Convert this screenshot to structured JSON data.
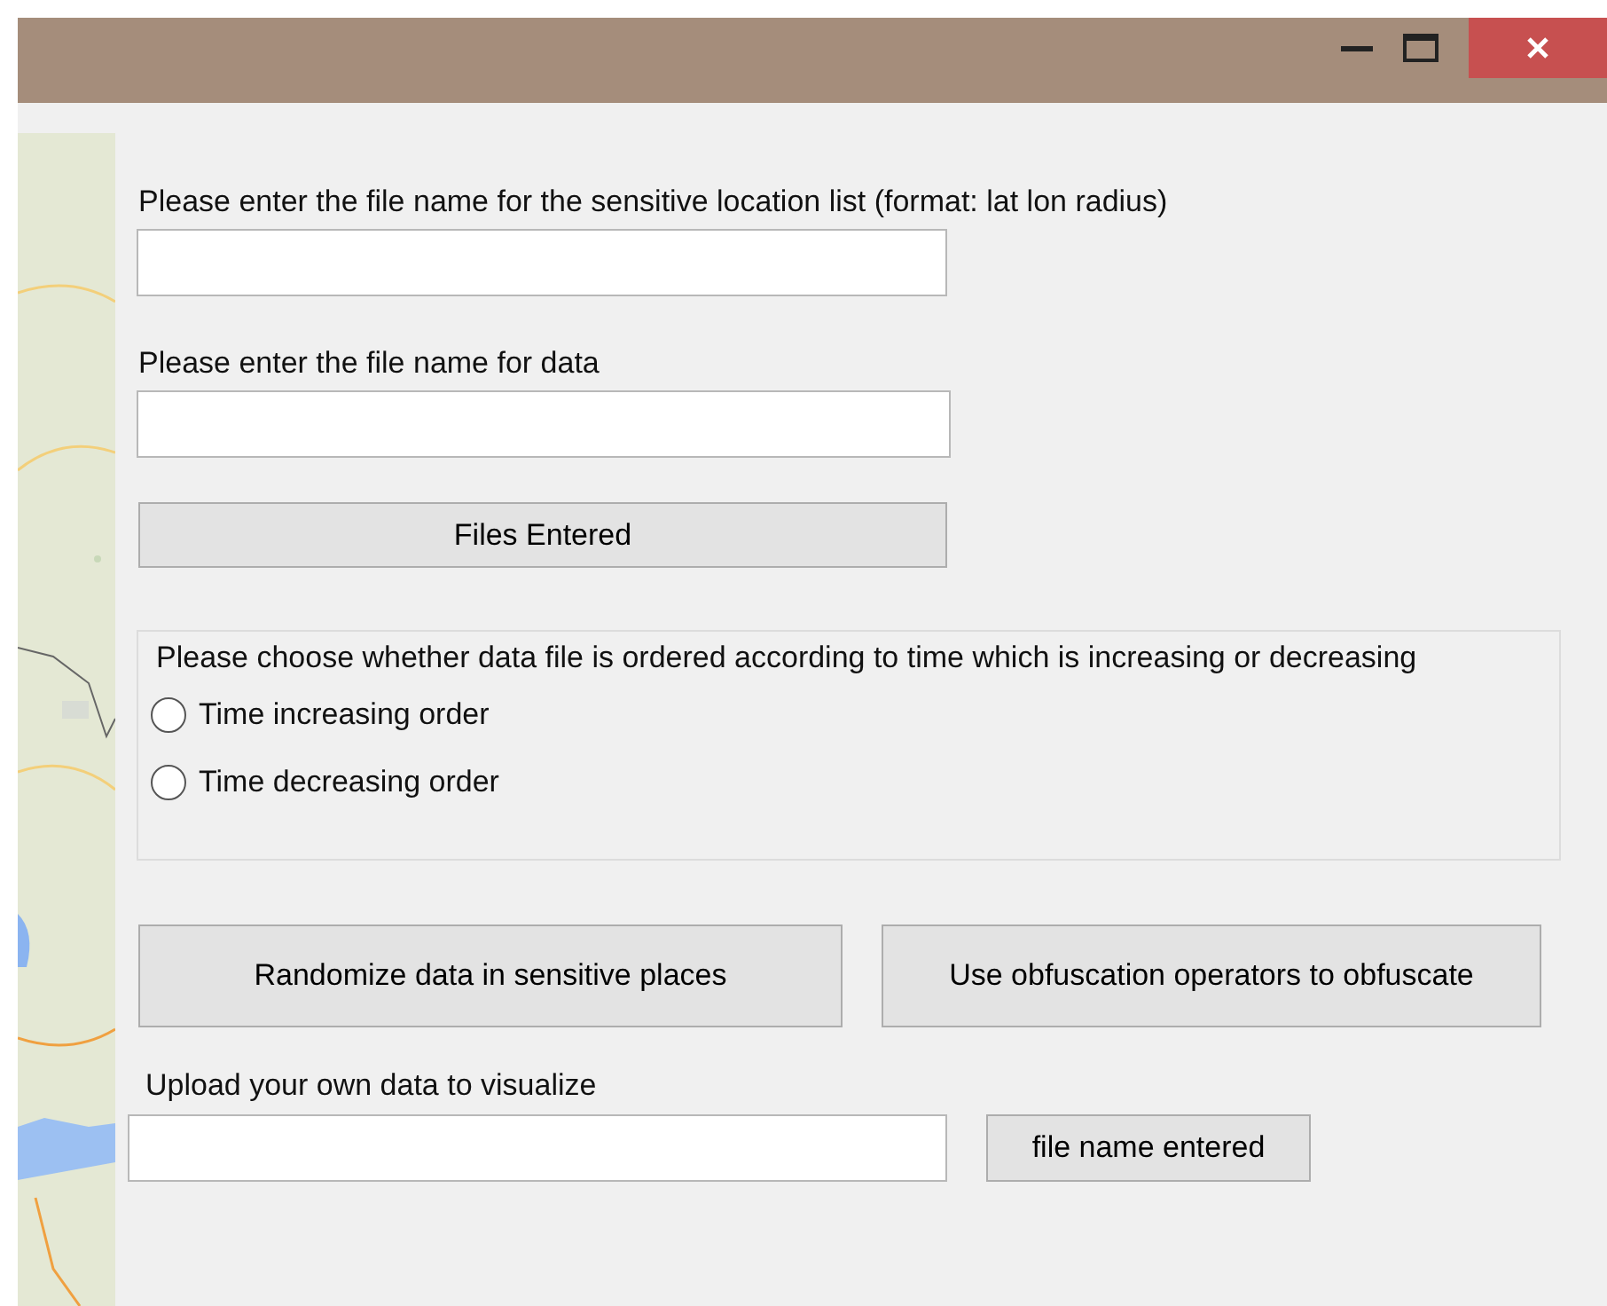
{
  "window": {
    "controls": [
      {
        "kind": "minimize"
      },
      {
        "kind": "maximize"
      },
      {
        "kind": "close"
      }
    ]
  },
  "map": {
    "kind": "picture"
  },
  "location_field": {
    "label": "Please enter the file name for the sensitive location list (format: lat lon radius)"
  },
  "data_field": {
    "label": "Please enter the file name for data"
  },
  "files_button": "Files Entered",
  "order_group": {
    "prompt": "Please choose whether data file is ordered according to time which is increasing or decreasing",
    "options": [
      {
        "label": "Time increasing order",
        "selected": false
      },
      {
        "label": "Time decreasing order",
        "selected": false
      }
    ]
  },
  "actions": [
    "Randomize data in sensitive places",
    "Use obfuscation operators to obfuscate"
  ],
  "upload": {
    "label": "Upload your own data to visualize",
    "button": "file name entered"
  }
}
